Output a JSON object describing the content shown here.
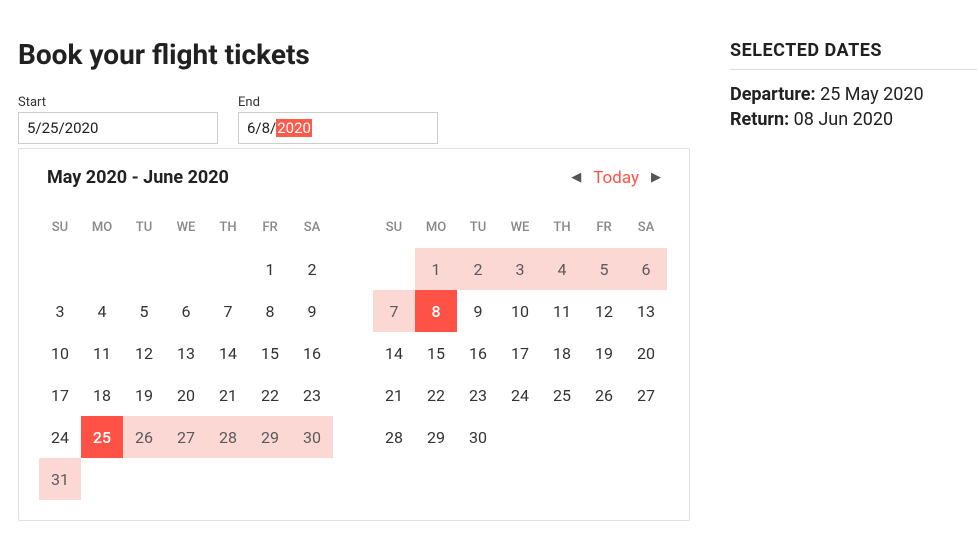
{
  "heading": "Book your flight tickets",
  "summary": {
    "title": "SELECTED DATES",
    "departure_label": "Departure:",
    "departure_value": "25 May 2020",
    "return_label": "Return:",
    "return_value": "08 Jun 2020"
  },
  "inputs": {
    "start_label": "Start",
    "start_value": "5/25/2020",
    "end_label": "End",
    "end_value_prefix": "6/8/",
    "end_value_selected": "2020"
  },
  "calendar": {
    "title": "May 2020 - June 2020",
    "today_label": "Today",
    "dow": [
      "SU",
      "MO",
      "TU",
      "WE",
      "TH",
      "FR",
      "SA"
    ],
    "months": [
      {
        "name": "May 2020",
        "leading_blanks": 5,
        "days": 31,
        "range": {
          "start": 25,
          "end": 31,
          "endpoint": 25
        }
      },
      {
        "name": "June 2020",
        "leading_blanks": 1,
        "days": 30,
        "range": {
          "start": 1,
          "end": 8,
          "endpoint": 8
        }
      }
    ]
  }
}
